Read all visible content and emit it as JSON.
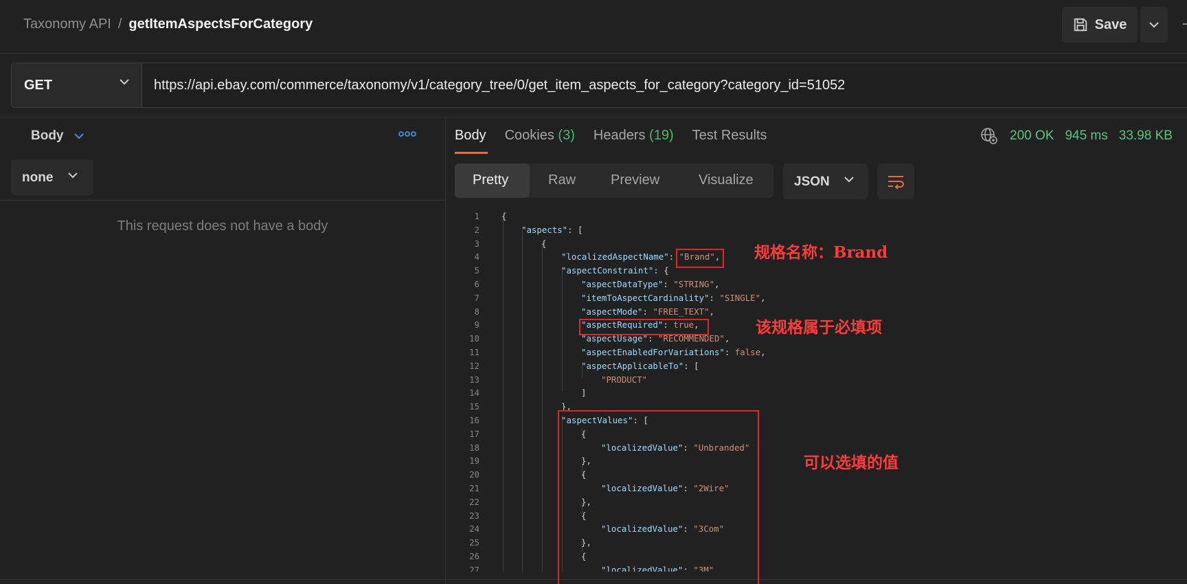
{
  "header": {
    "breadcrumb_parent": "Taxonomy API",
    "breadcrumb_sep": "/",
    "breadcrumb_current": "getItemAspectsForCategory",
    "save_label": "Save"
  },
  "request": {
    "method": "GET",
    "url": "https://api.ebay.com/commerce/taxonomy/v1/category_tree/0/get_item_aspects_for_category?category_id=51052",
    "body_tab": "Body",
    "body_type": "none",
    "no_body_text": "This request does not have a body"
  },
  "response": {
    "tabs": {
      "body": "Body",
      "cookies": "Cookies",
      "cookies_count": "(3)",
      "headers": "Headers",
      "headers_count": "(19)",
      "tests": "Test Results"
    },
    "status": "200 OK",
    "time": "945 ms",
    "size": "33.98 KB",
    "view_modes": {
      "pretty": "Pretty",
      "raw": "Raw",
      "preview": "Preview",
      "visualize": "Visualize"
    },
    "format": "JSON"
  },
  "code": {
    "line_numbers": [
      "1",
      "2",
      "3",
      "4",
      "5",
      "6",
      "7",
      "8",
      "9",
      "10",
      "11",
      "12",
      "13",
      "14",
      "15",
      "16",
      "17",
      "18",
      "19",
      "20",
      "21",
      "22",
      "23",
      "24",
      "25",
      "26",
      "27"
    ],
    "l1": "{",
    "l2_key": "\"aspects\"",
    "l2_rest": ": [",
    "l3": "{",
    "l4_key": "\"localizedAspectName\"",
    "l4_sep": ": ",
    "l4_val": "\"Brand\"",
    "l4_end": ",",
    "l5_key": "\"aspectConstraint\"",
    "l5_rest": ": {",
    "l6_key": "\"aspectDataType\"",
    "l6_sep": ": ",
    "l6_val": "\"STRING\"",
    "l6_end": ",",
    "l7_key": "\"itemToAspectCardinality\"",
    "l7_sep": ": ",
    "l7_val": "\"SINGLE\"",
    "l7_end": ",",
    "l8_key": "\"aspectMode\"",
    "l8_sep": ": ",
    "l8_val": "\"FREE_TEXT\"",
    "l8_end": ",",
    "l9_key": "\"aspectRequired\"",
    "l9_sep": ": ",
    "l9_val": "true",
    "l9_end": ",",
    "l10_key": "\"aspectUsage\"",
    "l10_sep": ": ",
    "l10_val": "\"RECOMMENDED\"",
    "l10_end": ",",
    "l11_key": "\"aspectEnabledForVariations\"",
    "l11_sep": ": ",
    "l11_val": "false",
    "l11_end": ",",
    "l12_key": "\"aspectApplicableTo\"",
    "l12_rest": ": [",
    "l13_val": "\"PRODUCT\"",
    "l14": "]",
    "l15": "},",
    "l16_key": "\"aspectValues\"",
    "l16_rest": ": [",
    "l17": "{",
    "l18_key": "\"localizedValue\"",
    "l18_sep": ": ",
    "l18_val": "\"Unbranded\"",
    "l19": "},",
    "l20": "{",
    "l21_key": "\"localizedValue\"",
    "l21_sep": ": ",
    "l21_val": "\"2Wire\"",
    "l22": "},",
    "l23": "{",
    "l24_key": "\"localizedValue\"",
    "l24_sep": ": ",
    "l24_val": "\"3Com\"",
    "l25": "},",
    "l26": "{",
    "l27_key": "\"localizedValue\"",
    "l27_sep": ": ",
    "l27_val": "\"3M\""
  },
  "annotations": {
    "brand_note": "规格名称：Brand",
    "required_note": "该规格属于必填项",
    "values_note": "可以选填的值"
  },
  "colors": {
    "accent_orange": "#e66d3c",
    "status_green": "#5bc37f",
    "annotation_red": "#e0262a",
    "json_key": "#9cdcfe",
    "json_string": "#ce9178"
  }
}
